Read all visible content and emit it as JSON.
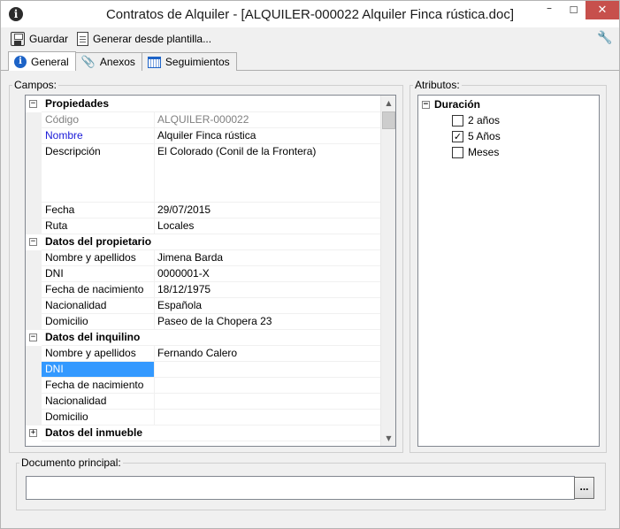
{
  "window": {
    "title": "Contratos de Alquiler - [ALQUILER-000022 Alquiler Finca  rústica.doc]",
    "min_glyph": "–",
    "max_glyph": "☐",
    "close_glyph": "✕",
    "app_icon_glyph": "i"
  },
  "toolbar": {
    "save_label": "Guardar",
    "generate_label": "Generar desde plantilla...",
    "settings_glyph": "🔧"
  },
  "tabs": [
    {
      "label": "General",
      "icon": "info-icon",
      "active": true
    },
    {
      "label": "Anexos",
      "icon": "paperclip-icon",
      "active": false
    },
    {
      "label": "Seguimientos",
      "icon": "calendar-icon",
      "active": false
    }
  ],
  "campos": {
    "title": "Campos:",
    "rows": [
      {
        "type": "cat",
        "label": "Propiedades",
        "expander": "−"
      },
      {
        "type": "prop",
        "label": "Código",
        "value": "ALQUILER-000022",
        "style": "ro"
      },
      {
        "type": "prop",
        "label": "Nombre",
        "value": "Alquiler Finca  rústica",
        "style": "blue"
      },
      {
        "type": "prop",
        "label": "Descripción",
        "value": "El Colorado (Conil de la Frontera)",
        "style": "tall"
      },
      {
        "type": "prop",
        "label": "Fecha",
        "value": "29/07/2015"
      },
      {
        "type": "prop",
        "label": "Ruta",
        "value": "Locales"
      },
      {
        "type": "cat",
        "label": "Datos del propietario",
        "expander": "−"
      },
      {
        "type": "prop",
        "label": "Nombre y apellidos",
        "value": "Jimena Barda"
      },
      {
        "type": "prop",
        "label": "DNI",
        "value": "0000001-X"
      },
      {
        "type": "prop",
        "label": "Fecha de nacimiento",
        "value": "18/12/1975"
      },
      {
        "type": "prop",
        "label": "Nacionalidad",
        "value": "Española"
      },
      {
        "type": "prop",
        "label": "Domicilio",
        "value": "Paseo de la Chopera 23"
      },
      {
        "type": "cat",
        "label": "Datos del inquilino",
        "expander": "−"
      },
      {
        "type": "prop",
        "label": "Nombre y apellidos",
        "value": "Fernando Calero"
      },
      {
        "type": "prop",
        "label": "DNI",
        "value": "",
        "style": "sel"
      },
      {
        "type": "prop",
        "label": "Fecha de nacimiento",
        "value": ""
      },
      {
        "type": "prop",
        "label": "Nacionalidad",
        "value": ""
      },
      {
        "type": "prop",
        "label": "Domicilio",
        "value": ""
      },
      {
        "type": "cat",
        "label": "Datos del inmueble",
        "expander": "+"
      }
    ],
    "scroll_up_glyph": "▲",
    "scroll_down_glyph": "▼"
  },
  "atributos": {
    "title": "Atributos:",
    "root": {
      "label": "Duración",
      "expander": "−"
    },
    "options": [
      {
        "label": "2 años",
        "checked": false
      },
      {
        "label": "5 Años",
        "checked": true
      },
      {
        "label": "Meses",
        "checked": false
      }
    ],
    "check_glyph": "✓"
  },
  "documento": {
    "title": "Documento principal:",
    "value": "",
    "browse_label": "..."
  }
}
